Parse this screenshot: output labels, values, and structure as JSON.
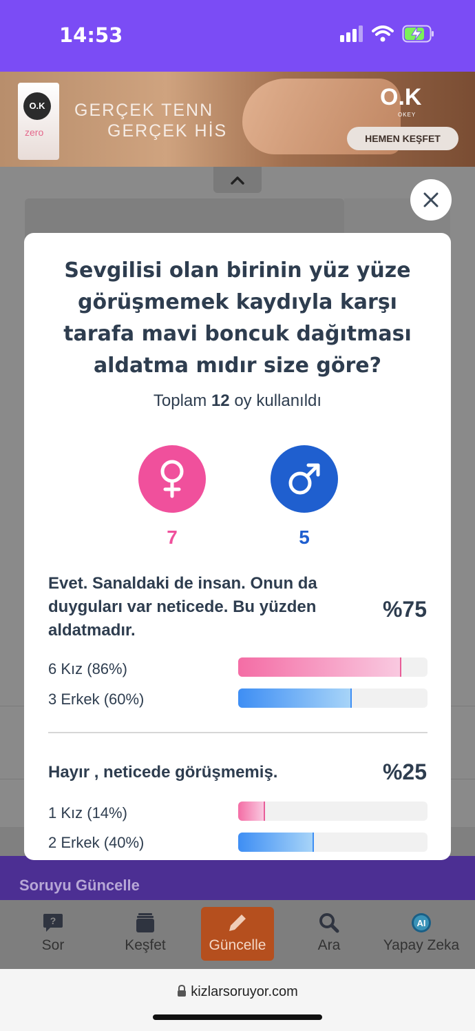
{
  "status_bar": {
    "time": "14:53"
  },
  "ad": {
    "box_logo": "O.K",
    "box_variant": "zero",
    "line1": "GERÇEK TENN",
    "line2": "GERÇEK HİS",
    "brand": "O.K",
    "brand_sub": "OKEY",
    "cta": "HEMEN KEŞFET"
  },
  "background_page": {
    "answer_preview": "Evet. Sanaldaki de insan. Onun da",
    "update_title": "Soruyu Güncelle"
  },
  "poll": {
    "question": "Sevgilisi olan birinin yüz yüze görüşmemek kaydıyla karşı tarafa mavi boncuk dağıtması aldatma mıdır size göre?",
    "total_prefix": "Toplam",
    "total_count": "12",
    "total_suffix": "oy kullanıldı",
    "female_count": "7",
    "male_count": "5",
    "female_color": "#f0509c",
    "male_color": "#1f5fcf",
    "options": [
      {
        "text": "Evet. Sanaldaki de insan. Onun da duyguları var neticede. Bu yüzden aldatmadır.",
        "percent": "%75",
        "female_label": "6 Kız (86%)",
        "female_fraction": 0.86,
        "male_label": "3 Erkek (60%)",
        "male_fraction": 0.6
      },
      {
        "text": "Hayır , neticede görüşmemiş.",
        "percent": "%25",
        "female_label": "1 Kız (14%)",
        "female_fraction": 0.14,
        "male_label": "2 Erkek (40%)",
        "male_fraction": 0.4
      }
    ]
  },
  "bottom_nav": [
    {
      "label": "Sor",
      "icon": "question-bubble-icon"
    },
    {
      "label": "Keşfet",
      "icon": "stack-icon"
    },
    {
      "label": "Güncelle",
      "icon": "pencil-icon",
      "active": true
    },
    {
      "label": "Ara",
      "icon": "search-icon"
    },
    {
      "label": "Yapay Zeka",
      "icon": "ai-icon"
    }
  ],
  "browser": {
    "url": "kizlarsoruyor.com"
  }
}
